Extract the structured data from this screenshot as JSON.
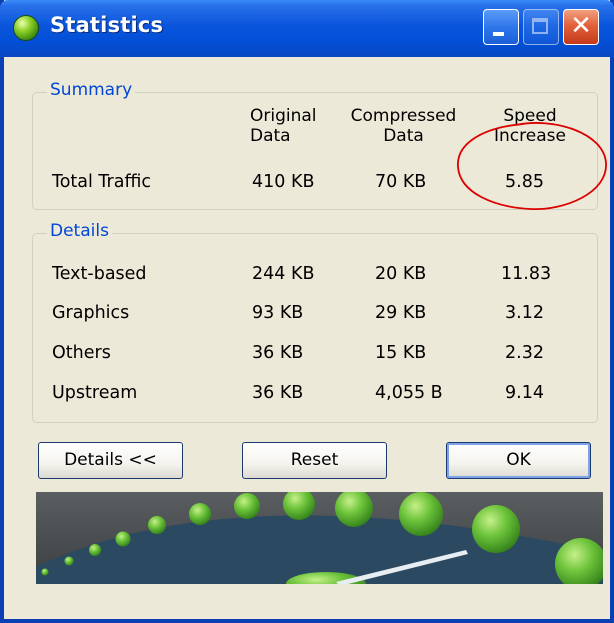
{
  "window": {
    "title": "Statistics",
    "accent_color": "#0a55dc",
    "icons": [
      "app-icon",
      "minimize-icon",
      "maximize-icon",
      "close-icon"
    ],
    "close_glyph": "✕"
  },
  "summary": {
    "legend": "Summary",
    "headers": {
      "original_line1": "Original",
      "original_line2": "Data",
      "compressed_line1": "Compressed",
      "compressed_line2": "Data",
      "speed_line1": "Speed",
      "speed_line2": "Increase"
    },
    "total": {
      "label": "Total Traffic",
      "original": "410 KB",
      "compressed": "70 KB",
      "speed": "5.85"
    }
  },
  "details": {
    "legend": "Details",
    "rows": [
      {
        "label": "Text-based",
        "original": "244 KB",
        "compressed": "20 KB",
        "speed": "11.83"
      },
      {
        "label": "Graphics",
        "original": "93 KB",
        "compressed": "29 KB",
        "speed": "3.12"
      },
      {
        "label": "Others",
        "original": "36 KB",
        "compressed": "15 KB",
        "speed": "2.32"
      },
      {
        "label": "Upstream",
        "original": "36 KB",
        "compressed": "4,055 B",
        "speed": "9.14"
      }
    ]
  },
  "buttons": {
    "details_label": "Details <<",
    "reset_label": "Reset",
    "ok_label": "OK"
  },
  "annotation": {
    "color": "#dd0000"
  },
  "banner": {
    "background_color": "#2b4a62",
    "dot_color": "#5cb834"
  }
}
